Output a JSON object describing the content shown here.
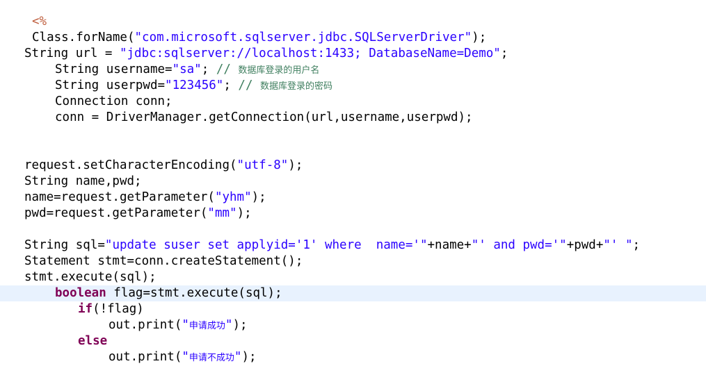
{
  "editor": {
    "lines": [
      {
        "id": "l1",
        "indent": "",
        "tokens": [
          {
            "t": "tag",
            "v": "<%"
          }
        ]
      },
      {
        "id": "l2",
        "tokens": [
          {
            "t": "txt",
            "v": "Class.forName("
          },
          {
            "t": "str",
            "v": "\"com.microsoft.sqlserver.jdbc.SQLServerDriver\""
          },
          {
            "t": "txt",
            "v": ");"
          }
        ]
      },
      {
        "id": "l3",
        "tokens": [
          {
            "t": "txt",
            "v": "String url = "
          },
          {
            "t": "str",
            "v": "\"jdbc:sqlserver://localhost:1433; DatabaseName=Demo\""
          },
          {
            "t": "txt",
            "v": ";"
          }
        ]
      },
      {
        "id": "l4",
        "tokens": [
          {
            "t": "txt",
            "v": "String username="
          },
          {
            "t": "str",
            "v": "\"sa\""
          },
          {
            "t": "txt",
            "v": "; "
          },
          {
            "t": "cmt",
            "v": "// "
          },
          {
            "t": "cmtcjk",
            "v": "数据库登录的用户名"
          }
        ]
      },
      {
        "id": "l5",
        "tokens": [
          {
            "t": "txt",
            "v": "String userpwd="
          },
          {
            "t": "str",
            "v": "\"123456\""
          },
          {
            "t": "txt",
            "v": "; "
          },
          {
            "t": "cmt",
            "v": "// "
          },
          {
            "t": "cmtcjk",
            "v": "数据库登录的密码"
          }
        ]
      },
      {
        "id": "l6",
        "tokens": [
          {
            "t": "txt",
            "v": "Connection conn;"
          }
        ]
      },
      {
        "id": "l7",
        "tokens": [
          {
            "t": "txt",
            "v": "conn = DriverManager.getConnection(url,username,userpwd);"
          }
        ]
      },
      {
        "id": "l8",
        "tokens": [
          {
            "t": "txt",
            "v": "request.setCharacterEncoding("
          },
          {
            "t": "str",
            "v": "\"utf-8\""
          },
          {
            "t": "txt",
            "v": ");"
          }
        ]
      },
      {
        "id": "l9",
        "tokens": [
          {
            "t": "txt",
            "v": "String name,pwd;"
          }
        ]
      },
      {
        "id": "l10",
        "tokens": [
          {
            "t": "txt",
            "v": "name=request.getParameter("
          },
          {
            "t": "str",
            "v": "\"yhm\""
          },
          {
            "t": "txt",
            "v": ");"
          }
        ]
      },
      {
        "id": "l11",
        "tokens": [
          {
            "t": "txt",
            "v": "pwd=request.getParameter("
          },
          {
            "t": "str",
            "v": "\"mm\""
          },
          {
            "t": "txt",
            "v": ");"
          }
        ]
      },
      {
        "id": "l12",
        "tokens": [
          {
            "t": "txt",
            "v": "String sql="
          },
          {
            "t": "str",
            "v": "\"update suser set applyid='1' where  name='\""
          },
          {
            "t": "txt",
            "v": "+name+"
          },
          {
            "t": "str",
            "v": "\"' and pwd='\""
          },
          {
            "t": "txt",
            "v": "+pwd+"
          },
          {
            "t": "str",
            "v": "\"' \""
          },
          {
            "t": "txt",
            "v": ";"
          }
        ]
      },
      {
        "id": "l13",
        "tokens": [
          {
            "t": "txt",
            "v": "Statement stmt=conn.createStatement();"
          }
        ]
      },
      {
        "id": "l14",
        "tokens": [
          {
            "t": "txt",
            "v": "stmt.execute(sql);"
          }
        ]
      },
      {
        "id": "l15",
        "tokens": [
          {
            "t": "kw",
            "v": "boolean"
          },
          {
            "t": "txt",
            "v": " flag=stmt.execute(sql);"
          }
        ]
      },
      {
        "id": "l16",
        "tokens": [
          {
            "t": "kw",
            "v": "if"
          },
          {
            "t": "txt",
            "v": "(!flag)"
          }
        ]
      },
      {
        "id": "l17",
        "tokens": [
          {
            "t": "txt",
            "v": "out.print("
          },
          {
            "t": "str",
            "v": "\""
          },
          {
            "t": "strcjk",
            "v": "申请成功"
          },
          {
            "t": "str",
            "v": "\""
          },
          {
            "t": "txt",
            "v": ");"
          }
        ]
      },
      {
        "id": "l18",
        "tokens": [
          {
            "t": "kw",
            "v": "else"
          }
        ]
      },
      {
        "id": "l19",
        "tokens": [
          {
            "t": "txt",
            "v": "out.print("
          },
          {
            "t": "str",
            "v": "\""
          },
          {
            "t": "strcjk",
            "v": "申请不成功"
          },
          {
            "t": "str",
            "v": "\""
          },
          {
            "t": "txt",
            "v": ");"
          }
        ]
      }
    ]
  }
}
